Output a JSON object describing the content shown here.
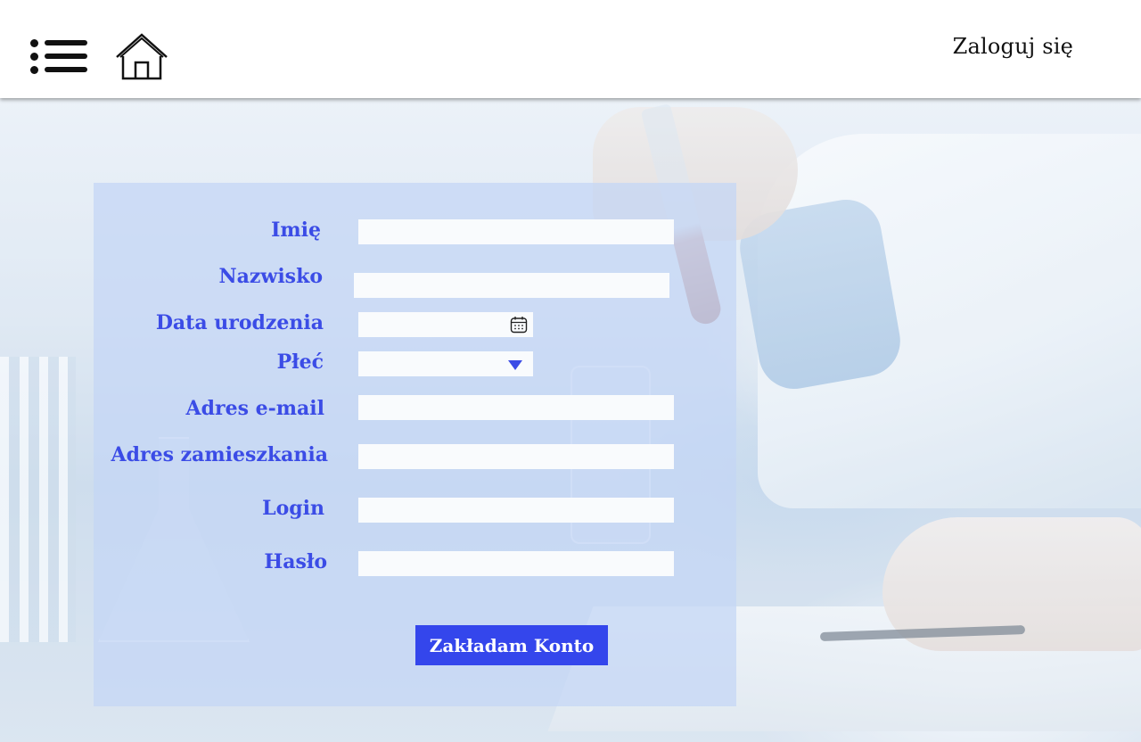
{
  "header": {
    "menu_icon": "hamburger-menu-icon",
    "home_icon": "home-icon",
    "login_label": "Zaloguj się"
  },
  "form": {
    "fields": [
      {
        "label": "Imię",
        "value": "",
        "type": "text"
      },
      {
        "label": "Nazwisko",
        "value": "",
        "type": "text"
      },
      {
        "label": "Data urodzenia",
        "value": "",
        "type": "date",
        "icon": "calendar-icon"
      },
      {
        "label": "Płeć",
        "value": "",
        "type": "select",
        "icon": "dropdown-caret-icon"
      },
      {
        "label": "Adres e-mail",
        "value": "",
        "type": "text"
      },
      {
        "label": "Adres zamieszkania",
        "value": "",
        "type": "text"
      },
      {
        "label": "Login",
        "value": "",
        "type": "text"
      },
      {
        "label": "Hasło",
        "value": "",
        "type": "password"
      }
    ],
    "submit_label": "Zakładam Konto"
  },
  "colors": {
    "accent": "#3446ec",
    "label_text": "#3b4ce6",
    "panel": "#c4d6f5",
    "header_bg": "#ffffff"
  }
}
